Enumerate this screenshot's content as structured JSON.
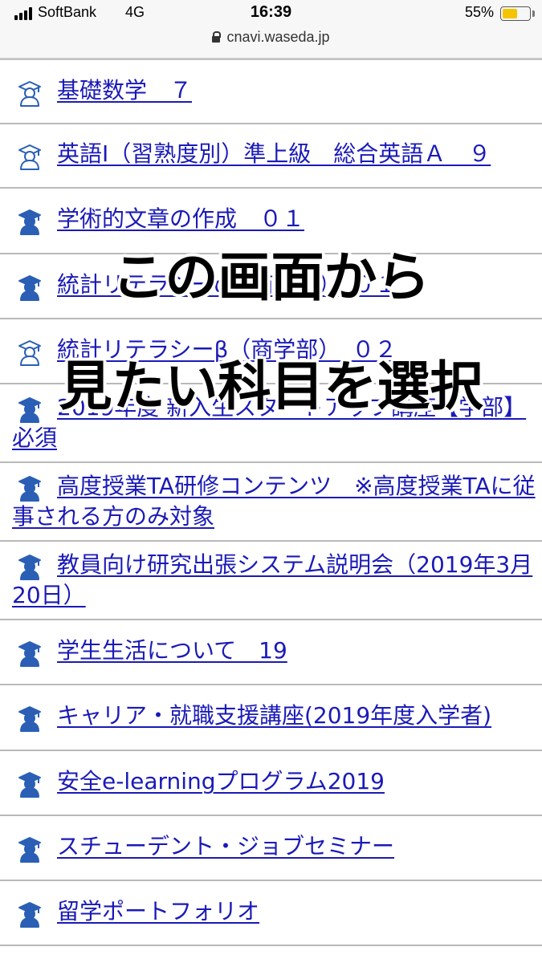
{
  "status_bar": {
    "carrier": "SoftBank",
    "network": "4G",
    "time": "16:39",
    "battery_percent": "55%",
    "battery_level": 0.55,
    "battery_color": "#f5c400"
  },
  "browser": {
    "url": "cnavi.waseda.jp",
    "lock_icon": "lock-icon"
  },
  "courses": [
    {
      "label": "基礎数学　７",
      "icon": "graduate-icon-outline"
    },
    {
      "label": "英語Ⅰ（習熟度別）準上級　総合英語Ａ　９",
      "icon": "graduate-icon-outline"
    },
    {
      "label": "学術的文章の作成　０１",
      "icon": "graduate-icon-filled"
    },
    {
      "label": "統計リテラシーα（商学部）　０１",
      "icon": "graduate-icon-filled"
    },
    {
      "label": "統計リテラシーβ（商学部）　０２",
      "icon": "graduate-icon-outline"
    },
    {
      "label": "2019年度 新入生スタートアップ講座【学部】必須",
      "icon": "graduate-icon-filled"
    },
    {
      "label": "高度授業TA研修コンテンツ　※高度授業TAに従事される方のみ対象",
      "icon": "graduate-icon-filled"
    },
    {
      "label": "教員向け研究出張システム説明会（2019年3月20日）",
      "icon": "graduate-icon-filled"
    },
    {
      "label": "学生生活について　19",
      "icon": "graduate-icon-filled"
    },
    {
      "label": "キャリア・就職支援講座(2019年度入学者)",
      "icon": "graduate-icon-filled"
    },
    {
      "label": "安全e-learningプログラム2019",
      "icon": "graduate-icon-filled"
    },
    {
      "label": "スチューデント・ジョブセミナー",
      "icon": "graduate-icon-filled"
    },
    {
      "label": "留学ポートフォリオ",
      "icon": "graduate-icon-filled"
    }
  ],
  "overlay": {
    "line1": "この画面から",
    "line2": "見たい科目を選択"
  },
  "colors": {
    "link": "#1a1ab8",
    "icon_blue": "#2a5fb5",
    "divider": "#b9b9b9"
  }
}
